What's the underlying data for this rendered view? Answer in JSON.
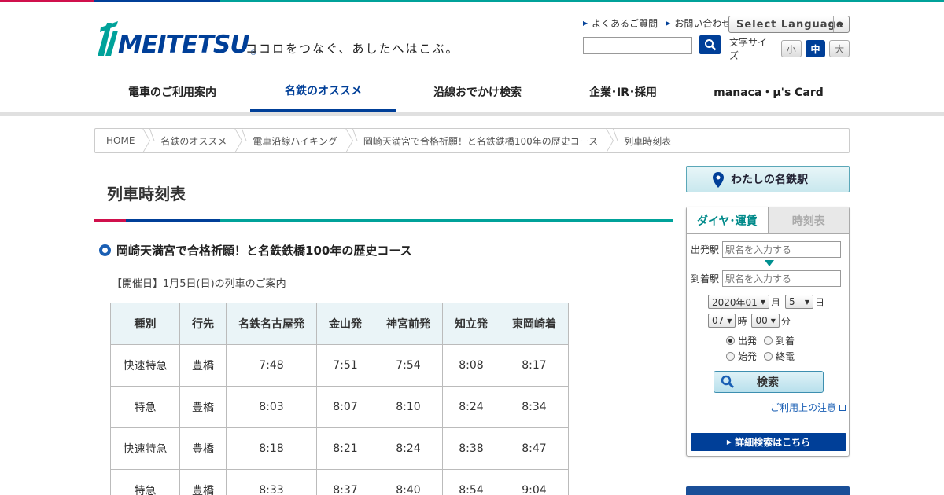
{
  "header": {
    "logo_text": "MEITETSU",
    "logo_reg": "®",
    "tagline": "ココロをつなぐ、あしたへはこぶ。",
    "links": [
      "よくあるご質問",
      "お問い合わせ"
    ],
    "language_label": "Select Language",
    "font_size_label": "文字サイズ",
    "font_sizes": [
      "小",
      "中",
      "大"
    ]
  },
  "nav": {
    "items": [
      "電車のご利用案内",
      "名鉄のオススメ",
      "沿線おでかけ検索",
      "企業･IR･採用",
      "manaca・μ's Card"
    ]
  },
  "breadcrumb": [
    "HOME",
    "名鉄のオススメ",
    "電車沿線ハイキング",
    "岡崎天満宮で合格祈願！と名鉄鉄橋100年の歴史コース",
    "列車時刻表"
  ],
  "main": {
    "title": "列車時刻表",
    "course_title": "岡崎天満宮で合格祈願！と名鉄鉄橋100年の歴史コース",
    "date_note": "【開催日】1月5日(日)の列車のご案内",
    "table": {
      "headers": [
        "種別",
        "行先",
        "名鉄名古屋発",
        "金山発",
        "神宮前発",
        "知立発",
        "東岡崎着"
      ],
      "rows": [
        [
          "快速特急",
          "豊橋",
          "7:48",
          "7:51",
          "7:54",
          "8:08",
          "8:17"
        ],
        [
          "特急",
          "豊橋",
          "8:03",
          "8:07",
          "8:10",
          "8:24",
          "8:34"
        ],
        [
          "快速特急",
          "豊橋",
          "8:18",
          "8:21",
          "8:24",
          "8:38",
          "8:47"
        ],
        [
          "特急",
          "豊橋",
          "8:33",
          "8:37",
          "8:40",
          "8:54",
          "9:04"
        ]
      ]
    }
  },
  "sidebar": {
    "my_meitetsu": "わたしの名鉄駅",
    "tabs": [
      "ダイヤ･運賃",
      "時刻表"
    ],
    "from_label": "出発駅",
    "to_label": "到着駅",
    "from_placeholder": "駅名を入力する",
    "to_placeholder": "駅名を入力する",
    "year_month": "2020年01",
    "month_unit": "月",
    "day": "5",
    "day_unit": "日",
    "hour": "07",
    "hour_unit": "時",
    "minute": "00",
    "minute_unit": "分",
    "radios": [
      "出発",
      "到着",
      "始発",
      "終電"
    ],
    "search_label": "検索",
    "notice": "ご利用上の注意",
    "detail_search": "詳細検索はこちら"
  }
}
